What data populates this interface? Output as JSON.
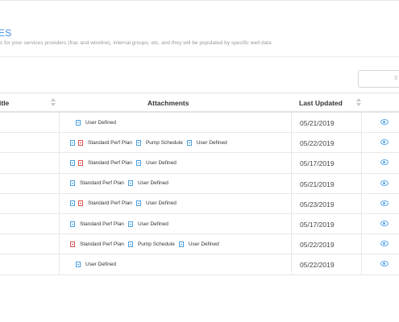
{
  "header": {
    "title": "ES",
    "description": "s for your services providers (frac and wireline), internal groups, etc. and they will be populated by specific well data"
  },
  "search": {
    "placeholder": "S"
  },
  "columns": {
    "title": "itle",
    "attachments": "Attachments",
    "last_updated": "Last Updated"
  },
  "rows": [
    {
      "icons": [
        "doc"
      ],
      "attachments": [
        {
          "icons": [
            "doc"
          ],
          "label": "User Defined"
        }
      ],
      "date": "05/21/2019"
    },
    {
      "attachments": [
        {
          "icons": [
            "doc",
            "pdf"
          ],
          "label": "Standard Perf Plan"
        },
        {
          "icons": [
            "doc"
          ],
          "label": "Pump Schedule"
        },
        {
          "icons": [
            "doc"
          ],
          "label": "User Defined"
        }
      ],
      "date": "05/22/2019"
    },
    {
      "attachments": [
        {
          "icons": [
            "doc",
            "pdf"
          ],
          "label": "Standard Perf Plan"
        },
        {
          "icons": [
            "doc"
          ],
          "label": "User Defined"
        }
      ],
      "date": "05/17/2019"
    },
    {
      "attachments": [
        {
          "icons": [
            "doc"
          ],
          "label": "Standard Perf Plan"
        },
        {
          "icons": [
            "doc"
          ],
          "label": "User Defined"
        }
      ],
      "date": "05/21/2019"
    },
    {
      "attachments": [
        {
          "icons": [
            "doc",
            "pdf"
          ],
          "label": "Standard Perf Plan"
        },
        {
          "icons": [
            "doc"
          ],
          "label": "User Defined"
        }
      ],
      "date": "05/23/2019"
    },
    {
      "attachments": [
        {
          "icons": [
            "doc"
          ],
          "label": "Standard Perf Plan"
        },
        {
          "icons": [
            "doc"
          ],
          "label": "User Defined"
        }
      ],
      "date": "05/17/2019"
    },
    {
      "attachments": [
        {
          "icons": [
            "pdf"
          ],
          "label": "Standard Perf Plan"
        },
        {
          "icons": [
            "doc"
          ],
          "label": "Pump Schedule"
        },
        {
          "icons": [
            "doc"
          ],
          "label": "User Defined"
        }
      ],
      "date": "05/22/2019"
    },
    {
      "attachments": [
        {
          "icons": [
            "doc"
          ],
          "label": "User Defined"
        }
      ],
      "date": "05/22/2019"
    }
  ],
  "icon_names": {
    "doc": "document-icon",
    "pdf": "pdf-icon",
    "view": "eye-icon",
    "sort": "sort-icon"
  },
  "colors": {
    "accent": "#3a8ee6",
    "doc_icon": "#4a9fe0",
    "pdf_icon": "#e05050"
  }
}
